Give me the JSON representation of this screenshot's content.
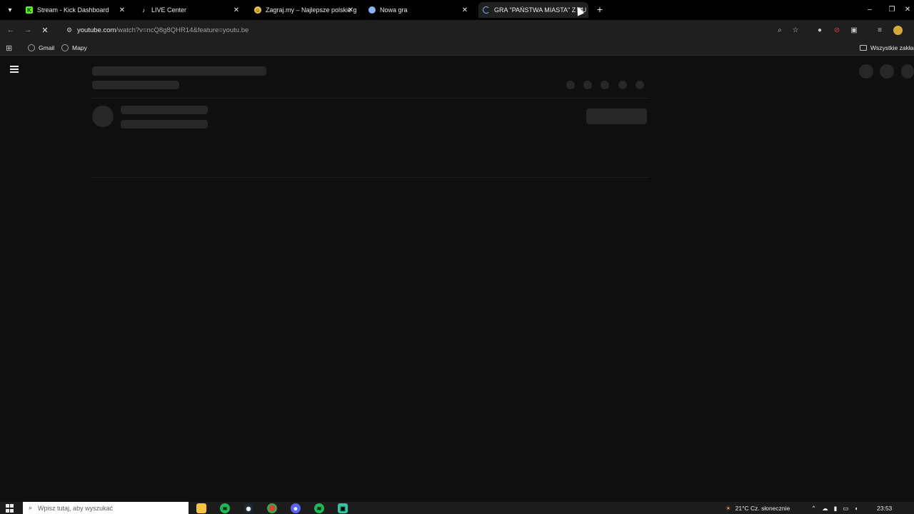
{
  "browser": {
    "tabs": [
      {
        "title": "Stream - Kick Dashboard",
        "icon": "kick-icon",
        "color": "#53fc18",
        "active": false
      },
      {
        "title": "LIVE Center",
        "icon": "tiktok-icon",
        "color": "#ffffff",
        "active": false
      },
      {
        "title": "Zagraj.my – Najlepsze polskie g",
        "icon": "zagraj-icon",
        "color": "#f5c542",
        "active": false
      },
      {
        "title": "Nowa gra",
        "icon": "globe-icon",
        "color": "#8ab4f8",
        "active": false
      },
      {
        "title": "GRA \"PAŃSTWA MIASTA\" Z BU",
        "icon": "loading-spinner-icon",
        "color": "#8ab4f8",
        "active": true
      }
    ],
    "new_tab_glyph": "+",
    "window_controls": {
      "minimize": "–",
      "restore": "❐",
      "close": "✕"
    }
  },
  "toolbar": {
    "url_domain": "youtube.com",
    "url_path": "/watch?v=ncQ8g8QHR14&feature=youtu.be"
  },
  "bookmarks": {
    "items": [
      {
        "label": "Gmail",
        "icon": "globe-icon"
      },
      {
        "label": "Mapy",
        "icon": "globe-icon"
      }
    ],
    "all_bookmarks": "Wszystkie zakład"
  },
  "taskbar": {
    "search_placeholder": "Wpisz tutaj, aby wyszukać",
    "weather": "21°C  Cz. słonecznie",
    "time": "23:53",
    "apps": [
      "file-explorer-icon",
      "spotify-icon",
      "steam-icon",
      "chrome-icon",
      "discord-icon",
      "spotify-icon",
      "streamlabs-icon"
    ]
  },
  "colors": {
    "page_bg": "#0f0f0f",
    "skeleton": "#272727",
    "chrome_bg": "#1f1f1f",
    "tabstrip_bg": "#000000"
  }
}
